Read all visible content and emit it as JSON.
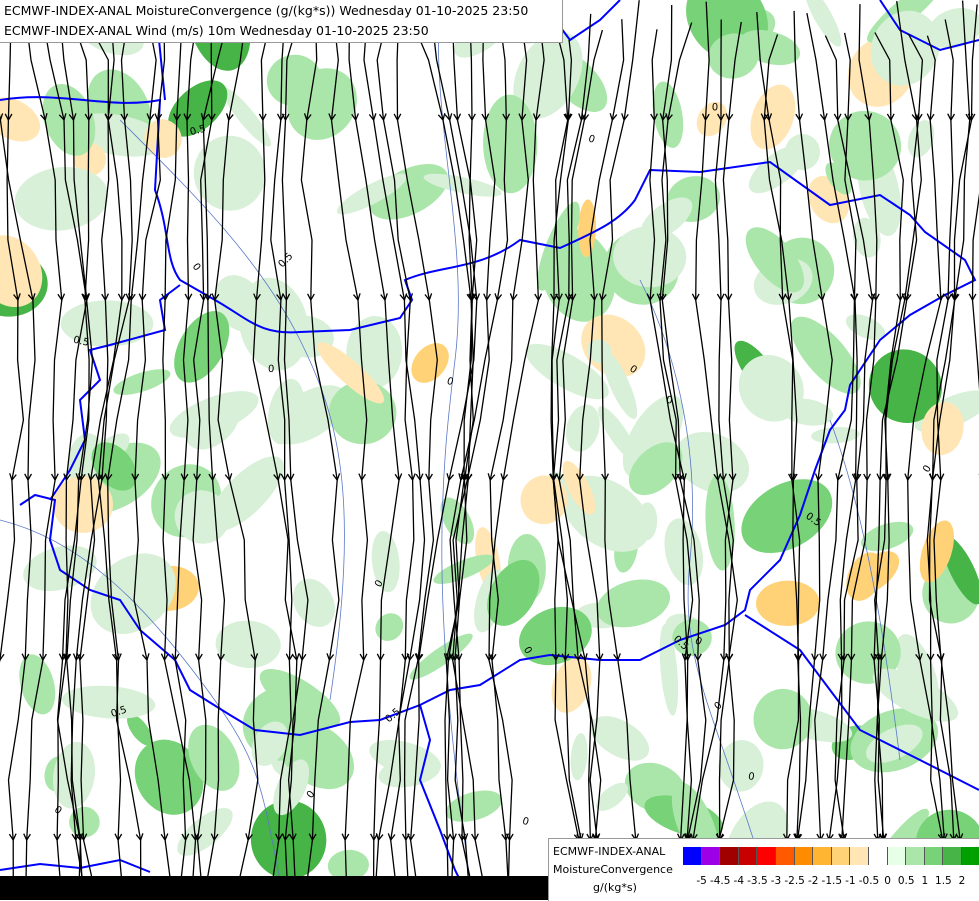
{
  "titles": {
    "line1": "ECMWF-INDEX-ANAL MoistureConvergence (g/(kg*s)) Wednesday 01-10-2025 23:50",
    "line2": "ECMWF-INDEX-ANAL Wind (m/s) 10m Wednesday 01-10-2025 23:50"
  },
  "legend": {
    "name_line1": "ECMWF-INDEX-ANAL",
    "name_line2": "MoistureConvergence",
    "units": "g/(kg*s)",
    "colors": [
      "#0000ff",
      "#9b00e6",
      "#a00000",
      "#c80000",
      "#ff0000",
      "#ff5a00",
      "#ff8c00",
      "#ffb432",
      "#ffd278",
      "#ffe6b4",
      "#ffffff",
      "#e6ffe6",
      "#aae6aa",
      "#78d278",
      "#46b446",
      "#00a000"
    ],
    "labels": [
      "-5",
      "-4.5",
      "-4",
      "-3.5",
      "-3",
      "-2.5",
      "-2",
      "-1.5",
      "-1",
      "-0.5",
      "0",
      "0.5",
      "1",
      "1.5",
      "2"
    ]
  },
  "contour_labels": [
    "0.5",
    "0",
    "0.5",
    "0",
    "0",
    "0.5",
    "0",
    "0",
    "0.5",
    "0",
    "0.5",
    "0",
    "0",
    "0",
    "0.5",
    "0",
    "0",
    "0",
    "0",
    "0",
    "0.5",
    "0",
    "0"
  ],
  "colors": {
    "border": "#0000ff",
    "streamline": "#000000",
    "convergence_green": "#aae6aa",
    "divergence_orange": "#ffd278",
    "river": "#5a78c8"
  }
}
